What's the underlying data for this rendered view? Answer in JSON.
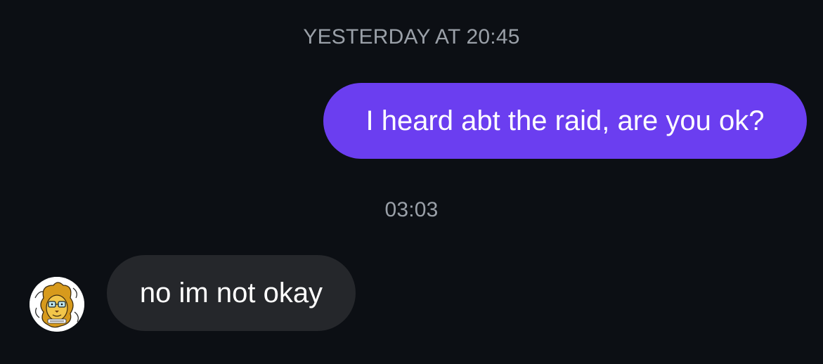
{
  "conversation": {
    "timestamps": [
      "YESTERDAY AT 20:45",
      "03:03"
    ],
    "messages": [
      {
        "direction": "outgoing",
        "text": "I heard abt the raid, are you ok?",
        "bubble_color": "#6b3ef0"
      },
      {
        "direction": "incoming",
        "text": "no im not okay",
        "bubble_color": "#25272b",
        "avatar_icon": "cartoon-lion-avatar-icon"
      }
    ]
  },
  "theme": {
    "background": "#0c0f14",
    "timestamp_color": "#9aa0a8",
    "text_color": "#ffffff"
  }
}
